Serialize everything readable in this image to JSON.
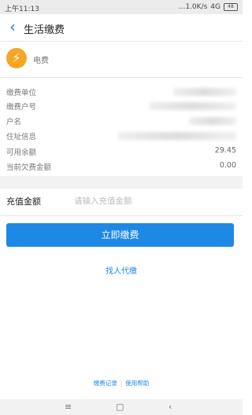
{
  "status_bar": {
    "time": "上午11:13",
    "network": "...1.0K/s",
    "signal": "4G",
    "battery": "48"
  },
  "header": {
    "title": "生活缴费"
  },
  "biller": {
    "name": "电费",
    "icon": "lightning-icon",
    "icon_color": "#f5a623"
  },
  "info": {
    "rows": [
      {
        "label": "缴费单位",
        "value": ""
      },
      {
        "label": "缴费户号",
        "value": ""
      },
      {
        "label": "户名",
        "value": ""
      },
      {
        "label": "住址信息",
        "value": ""
      },
      {
        "label": "可用余额",
        "value": "29.45"
      },
      {
        "label": "当前欠费金额",
        "value": "0.00"
      }
    ]
  },
  "amount": {
    "label": "充值金额",
    "placeholder": "请输入充值金额"
  },
  "actions": {
    "pay_label": "立即缴费",
    "proxy_label": "找人代缴"
  },
  "footer": {
    "records_label": "缴费记录",
    "help_label": "使用帮助"
  },
  "colors": {
    "accent": "#1e88e5",
    "background_gap": "#f2f2f2"
  }
}
